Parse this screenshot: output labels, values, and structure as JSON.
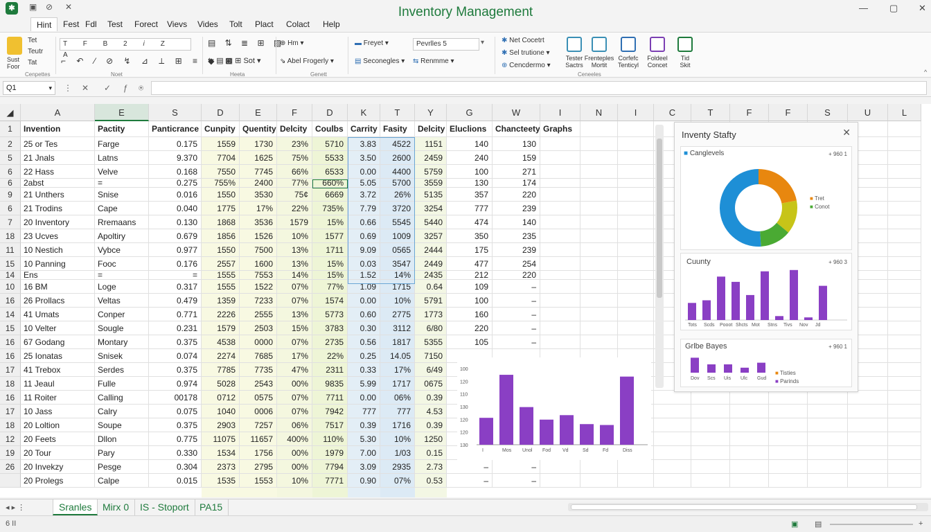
{
  "window": {
    "title": "Inventory Management",
    "minimize": "—",
    "restore": "▢",
    "close": "✕"
  },
  "menu": [
    "Hint",
    "Fest",
    "Fdl",
    "Test",
    "Forect",
    "Vievs",
    "Vides",
    "Tolt",
    "Plact",
    "Colact",
    "Help"
  ],
  "ribbon": {
    "paste_label": "Sust\nFoor",
    "clip": [
      "Tet",
      "Teutr",
      "Tat"
    ],
    "clip_group": "Cenpettes",
    "font_group": "Noet",
    "para_group": "Heeta",
    "style_group": "Genett",
    "sort_label": "Sot",
    "font_name_label": "Hm",
    "format_label": "Abel Frogerly",
    "freeze_label": "Freyet",
    "seconegles_label": "Seconegles",
    "rename_label": "Renmme",
    "style_box": "Pevrlles 5",
    "rt_lines": [
      "Net Cocetrt",
      "Sel trutione",
      "Cencdermo"
    ],
    "tiles": [
      {
        "label": "Tester\nSactrs",
        "color": "#3a8fb5"
      },
      {
        "label": "Frenteples\nMortit",
        "color": "#3a8fb5"
      },
      {
        "label": "Corfefc\nTenticyl",
        "color": "#2f6fb3"
      },
      {
        "label": "Foldeel\nConcet",
        "color": "#7b3fb3"
      },
      {
        "label": "Tid\nSkit",
        "color": "#1e7a3c"
      }
    ],
    "right_group": "Ceneeles"
  },
  "formula": {
    "namebox": "Q1",
    "input": ""
  },
  "columns": [
    "A",
    "E",
    "S",
    "D",
    "E",
    "F",
    "D",
    "K",
    "T",
    "Y",
    "G",
    "W",
    "I",
    "N",
    "I",
    "C",
    "T",
    "F",
    "F",
    "S",
    "U",
    "L"
  ],
  "header_row": [
    "Invention",
    "Pactity",
    "Panticrance",
    "Cunpity",
    "Quentity",
    "Delcity",
    "Coulbs",
    "Carrity",
    "Fasity",
    "Delcity",
    "Eluclions",
    "Chancteety",
    "Graphs"
  ],
  "row_numbers": [
    "1",
    "2",
    "5",
    "6",
    "6",
    "9",
    "6",
    "7",
    "18",
    "11",
    "15",
    "14",
    "10",
    "16",
    "14",
    "15",
    "16",
    "16",
    "17",
    "18",
    "16",
    "17",
    "18",
    "12",
    "19",
    "26"
  ],
  "rows": [
    [
      "25 or Tes",
      "Farge",
      "0.175",
      "1559",
      "1730",
      "23%",
      "5710",
      "3.83",
      "4522",
      "1151",
      "140",
      "130"
    ],
    [
      "21 Jnals",
      "Latns",
      "9.370",
      "7704",
      "1625",
      "75%",
      "5533",
      "3.50",
      "2600",
      "2459",
      "240",
      "159"
    ],
    [
      "22 Hass",
      "Velve",
      "0.168",
      "7550",
      "7745",
      "66%",
      "6533",
      "0.00",
      "4400",
      "5759",
      "100",
      "271"
    ],
    [
      "2abst",
      "=",
      "0.275",
      "755%",
      "2400",
      "77%",
      "660%",
      "5.05",
      "5700",
      "3559",
      "130",
      "174"
    ],
    [
      "21 Unthers",
      "Snise",
      "0.016",
      "1550",
      "3530",
      "75¢",
      "6669",
      "3.72",
      "26%",
      "5135",
      "357",
      "220"
    ],
    [
      "21 Trodins",
      "Cape",
      "0.040",
      "1775",
      "17%",
      "22%",
      "735%",
      "7.79",
      "3720",
      "3254",
      "777",
      "239"
    ],
    [
      "20 Inventory",
      "Rremaans",
      "0.130",
      "1868",
      "3536",
      "1579",
      "15%",
      "0.66",
      "5545",
      "5440",
      "474",
      "140"
    ],
    [
      "23 Ucves",
      "Apoltiry",
      "0.679",
      "1856",
      "1526",
      "10%",
      "1577",
      "0.69",
      "1009",
      "3257",
      "350",
      "235"
    ],
    [
      "10 Nestich",
      "Vybce",
      "0.977",
      "1550",
      "7500",
      "13%",
      "1711",
      "9.09",
      "0565",
      "2444",
      "175",
      "239"
    ],
    [
      "10 Panning",
      "Fooc",
      "0.176",
      "2557",
      "1600",
      "13%",
      "15%",
      "0.03",
      "3547",
      "2449",
      "477",
      "254"
    ],
    [
      "Ens",
      "=",
      "=",
      "1555",
      "7553",
      "14%",
      "15%",
      "1.52",
      "14%",
      "2435",
      "212",
      "220"
    ],
    [
      "16 BM",
      "Loge",
      "0.317",
      "1555",
      "1522",
      "07%",
      "77%",
      "1.09",
      "1715",
      "0.64",
      "109",
      "–"
    ],
    [
      "26 Prollacs",
      "Veltas",
      "0.479",
      "1359",
      "7233",
      "07%",
      "1574",
      "0.00",
      "10%",
      "5791",
      "100",
      "–"
    ],
    [
      "41 Umats",
      "Conper",
      "0.771",
      "2226",
      "2555",
      "13%",
      "5773",
      "0.60",
      "2775",
      "1773",
      "160",
      "–"
    ],
    [
      "10 Velter",
      "Sougle",
      "0.231",
      "1579",
      "2503",
      "15%",
      "3783",
      "0.30",
      "3112",
      "6/80",
      "220",
      "–"
    ],
    [
      "67 Godang",
      "Montary",
      "0.375",
      "4538",
      "0000",
      "07%",
      "2735",
      "0.56",
      "1817",
      "5355",
      "105",
      "–"
    ],
    [
      "25 Ionatas",
      "Snisek",
      "0.074",
      "2274",
      "7685",
      "17%",
      "22%",
      "0.25",
      "14.05",
      "7150",
      "",
      ""
    ],
    [
      "41 Trebox",
      "Serdes",
      "0.375",
      "7785",
      "7735",
      "47%",
      "2311",
      "0.33",
      "17%",
      "6/49",
      "",
      ""
    ],
    [
      "11 Jeaul",
      "Fulle",
      "0.974",
      "5028",
      "2543",
      "00%",
      "9835",
      "5.99",
      "1717",
      "0675",
      "",
      ""
    ],
    [
      "11 Roiter",
      "Calling",
      "00178",
      "0712",
      "0575",
      "07%",
      "7711",
      "0.00",
      "06%",
      "0.39",
      "",
      ""
    ],
    [
      "10 Jass",
      "Calry",
      "0.075",
      "1040",
      "0006",
      "07%",
      "7942",
      "777",
      "777",
      "4.53",
      "",
      ""
    ],
    [
      "20 Loltion",
      "Soupe",
      "0.375",
      "2903",
      "7257",
      "06%",
      "7517",
      "0.39",
      "1716",
      "0.39",
      "",
      ""
    ],
    [
      "20 Feets",
      "Dllon",
      "0.775",
      "11075",
      "11657",
      "400%",
      "110%",
      "5.30",
      "10%",
      "1250",
      "",
      ""
    ],
    [
      "20 Tour",
      "Pary",
      "0.330",
      "1534",
      "1756",
      "00%",
      "1979",
      "7.00",
      "1/03",
      "0.15",
      "",
      ""
    ],
    [
      "20 Invekzy",
      "Pesge",
      "0.304",
      "2373",
      "2795",
      "00%",
      "7794",
      "3.09",
      "2935",
      "2.73",
      "–",
      "–"
    ],
    [
      "20 Prolegs",
      "Calpe",
      "0.015",
      "1535",
      "1553",
      "10%",
      "7771",
      "0.90",
      "07%",
      "0.53",
      "–",
      "–"
    ]
  ],
  "panel": {
    "title": "Inventy Stafty",
    "donut_legend_label": "Canglevels",
    "donut_badge": "+ 960 1",
    "donut_items": [
      "Tret",
      "Conot"
    ],
    "donut_values": [
      22,
      14,
      13,
      51
    ],
    "donut_colors": [
      "#e8870f",
      "#c7c418",
      "#4aaa33",
      "#1e8fd6"
    ],
    "bar1_title": "Cuunty",
    "bar1_badge": "+ 960 3",
    "bar1_values": [
      26,
      30,
      66,
      58,
      38,
      74,
      6,
      76,
      4,
      52
    ],
    "bar1_labels": [
      "Tots",
      "Scds",
      "Pooot",
      "Shcts",
      "Mot",
      "Stns",
      "Tivs",
      "Nov",
      "Jd"
    ],
    "bar2_title": "Grlbe Bayes",
    "bar2_badge": "+ 960 1",
    "bar2_values": [
      18,
      10,
      10,
      6,
      12
    ],
    "bar2_labels": [
      "Dov",
      "Scs",
      "Uis",
      "Ulc",
      "Gud"
    ],
    "bar2_legend": [
      "Tisties",
      "Parinds"
    ]
  },
  "chart2": {
    "yticks": [
      "100",
      "120",
      "110",
      "130",
      "120",
      "120",
      "130"
    ],
    "values": [
      30,
      78,
      42,
      28,
      33,
      23,
      22,
      76
    ],
    "xlabels": [
      "I",
      "Mos",
      "Unol",
      "Fod",
      "Vd",
      "Sd",
      "Fd",
      "Diss"
    ]
  },
  "sheets": [
    "Sranles",
    "Mirx 0",
    "IS - Stoport",
    "PA15"
  ],
  "status": {
    "left": "6 II",
    "zoom": ""
  }
}
